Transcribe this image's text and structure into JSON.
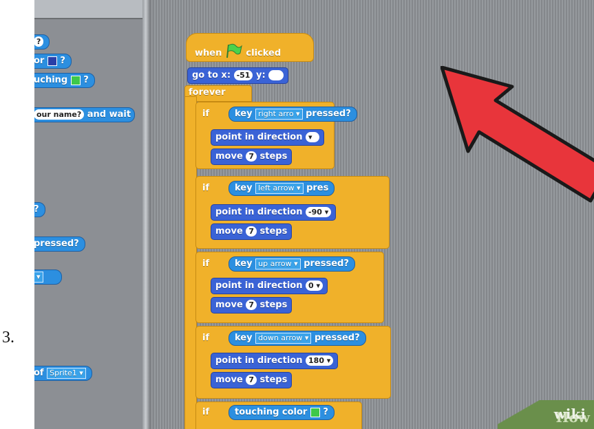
{
  "step": {
    "number": "3."
  },
  "palette": {
    "blocks": [
      {
        "text": "?"
      },
      {
        "text": "or",
        "tail": "?"
      },
      {
        "text": "uching",
        "tail": "?"
      },
      {
        "text": "our name?",
        "tail": "and wait"
      },
      {
        "text": "?"
      },
      {
        "text": "pressed?"
      },
      {
        "text": ""
      },
      {
        "text": "of",
        "menu": "Sprite1"
      }
    ]
  },
  "script": {
    "hat": {
      "when": "when",
      "clicked": "clicked"
    },
    "goto": {
      "label_x": "go to x:",
      "x": "-51",
      "label_y": "y:",
      "y": ""
    },
    "forever": "forever",
    "ifs": [
      {
        "if": "if",
        "key": "key",
        "menu": "right arro",
        "pressed": "pressed?",
        "point_label": "point in direction",
        "direction": "",
        "move_label": "move",
        "steps_value": "7",
        "steps": "steps"
      },
      {
        "if": "if",
        "key": "key",
        "menu": "left arrow",
        "pressed": "pres",
        "point_label": "point in direction",
        "direction": "-90",
        "move_label": "move",
        "steps_value": "7",
        "steps": "steps"
      },
      {
        "if": "if",
        "key": "key",
        "menu": "up arrow",
        "pressed": "pressed?",
        "point_label": "point in direction",
        "direction": "0",
        "move_label": "move",
        "steps_value": "7",
        "steps": "steps"
      },
      {
        "if": "if",
        "key": "key",
        "menu": "down arrow",
        "pressed": "pressed?",
        "point_label": "point in direction",
        "direction": "180",
        "move_label": "move",
        "steps_value": "7",
        "steps": "steps"
      }
    ],
    "touching": {
      "if": "if",
      "label": "touching color",
      "tail": "?"
    }
  },
  "watermark": {
    "wiki": "wiki",
    "how": "How"
  },
  "colors": {
    "sensing": "#2c8fe0",
    "motion": "#3a63d6",
    "control": "#f0b12a",
    "arrow": "#e8353b",
    "swatch_blue": "#2a3fa8",
    "swatch_green": "#3ec84a"
  },
  "icons": {
    "flag": "green-flag-icon",
    "pointer": "red-arrow-pointer"
  }
}
